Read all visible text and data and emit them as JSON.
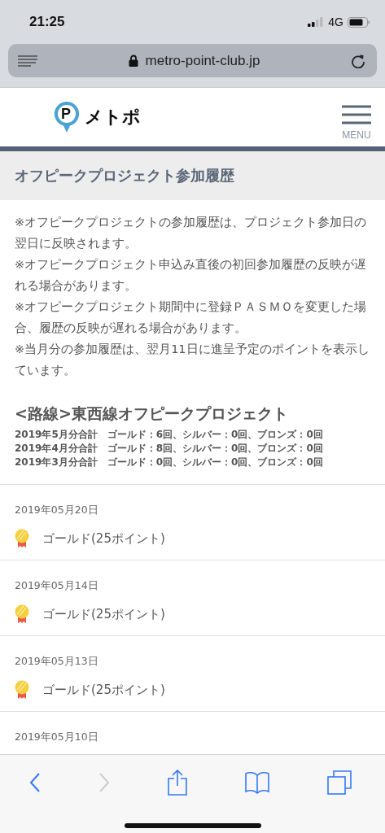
{
  "status_bar": {
    "time": "21:25",
    "network": "4G"
  },
  "browser": {
    "url": "metro-point-club.jp"
  },
  "header": {
    "logo_text": "メトポ",
    "logo_mark": "P",
    "menu_label": "MENU"
  },
  "page_title": "オフピークプロジェクト参加履歴",
  "notices": [
    "※オフピークプロジェクトの参加履歴は、プロジェクト参加日の翌日に反映されます。",
    "※オフピークプロジェクト申込み直後の初回参加履歴の反映が遅れる場合があります。",
    "※オフピークプロジェクト期間中に登録ＰＡＳＭＯを変更した場合、履歴の反映が遅れる場合があります。",
    "※当月分の参加履歴は、翌月11日に進呈予定のポイントを表示しています。"
  ],
  "project": {
    "title": "<路線>東西線オフピークプロジェクト",
    "totals": [
      {
        "month": "2019年5月分合計",
        "counts": "ゴールド：6回、シルバー：0回、ブロンズ：0回"
      },
      {
        "month": "2019年4月分合計",
        "counts": "ゴールド：8回、シルバー：0回、ブロンズ：0回"
      },
      {
        "month": "2019年3月分合計",
        "counts": "ゴールド：0回、シルバー：0回、ブロンズ：0回"
      }
    ]
  },
  "history": [
    {
      "date": "2019年05月20日",
      "color": "#f5cf3c",
      "award": "ゴールド(25ポイント)"
    },
    {
      "date": "2019年05月14日",
      "color": "#f5cf3c",
      "award": "ゴールド(25ポイント)"
    },
    {
      "date": "2019年05月13日",
      "color": "#f5cf3c",
      "award": "ゴールド(25ポイント)"
    },
    {
      "date": "2019年05月10日"
    }
  ],
  "toolbar": [
    {
      "kind": "back",
      "disabled": false
    },
    {
      "kind": "forward",
      "disabled": true
    },
    {
      "kind": "share",
      "disabled": false
    },
    {
      "kind": "bookmarks",
      "disabled": false
    },
    {
      "kind": "tabs",
      "disabled": false
    }
  ]
}
